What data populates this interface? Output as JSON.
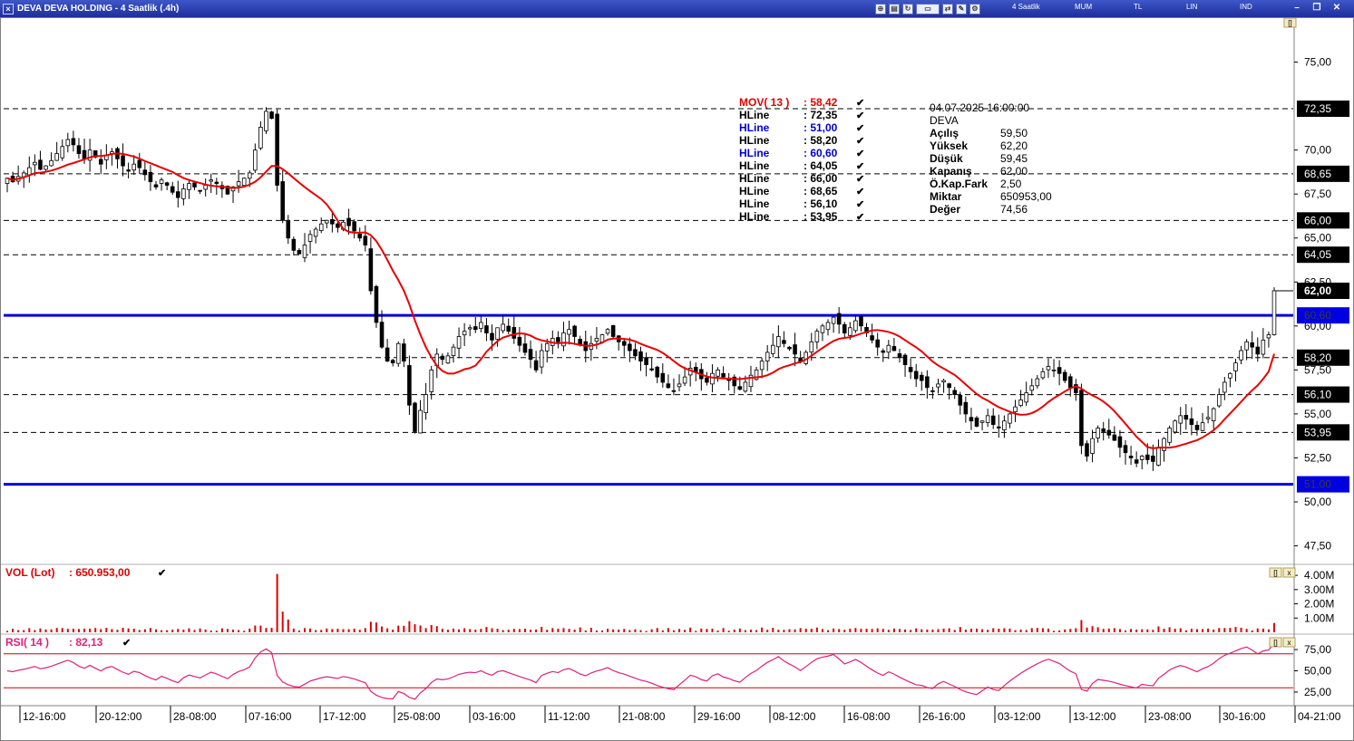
{
  "window": {
    "title": "DEVA DEVA HOLDING - 4 Saatlik (.4h)",
    "period_menu": "4 Saatlik",
    "menus": [
      "MUM",
      "TL",
      "LIN",
      "IND"
    ],
    "close_glyph": "×",
    "toolbar_icons": [
      "zoom-icon",
      "print-icon",
      "refresh-icon",
      "portfolio-icon",
      "compare-icon",
      "draw-icon",
      "settings-icon"
    ]
  },
  "price_panel": {
    "y_ticks": [
      "75,00",
      "70,00",
      "67,50",
      "65,00",
      "62,50",
      "60,00",
      "57,50",
      "55,00",
      "52,50",
      "50,00",
      "47,50"
    ],
    "price_tags": [
      {
        "text": "72,35",
        "value": 72.35,
        "kind": "line"
      },
      {
        "text": "68,65",
        "value": 68.65,
        "kind": "line"
      },
      {
        "text": "66,00",
        "value": 66.0,
        "kind": "line"
      },
      {
        "text": "64,05",
        "value": 64.05,
        "kind": "line"
      },
      {
        "text": "62,00",
        "value": 62.0,
        "kind": "price"
      },
      {
        "text": "60,60",
        "value": 60.6,
        "kind": "blue"
      },
      {
        "text": "58,20",
        "value": 58.2,
        "kind": "line"
      },
      {
        "text": "56,10",
        "value": 56.1,
        "kind": "line"
      },
      {
        "text": "53,95",
        "value": 53.95,
        "kind": "line"
      },
      {
        "text": "51,00",
        "value": 51.0,
        "kind": "blue"
      }
    ],
    "legend": [
      {
        "label": "MOV( 13 )",
        "value": ": 58,42",
        "color": "#e00000"
      },
      {
        "label": "HLine",
        "value": ": 72,35",
        "color": "#000000"
      },
      {
        "label": "HLine",
        "value": ": 51,00",
        "color": "#0000d0"
      },
      {
        "label": "HLine",
        "value": ": 58,20",
        "color": "#000000"
      },
      {
        "label": "HLine",
        "value": ": 60,60",
        "color": "#0000d0"
      },
      {
        "label": "HLine",
        "value": ": 64,05",
        "color": "#000000"
      },
      {
        "label": "HLine",
        "value": ": 66,00",
        "color": "#000000"
      },
      {
        "label": "HLine",
        "value": ": 68,65",
        "color": "#000000"
      },
      {
        "label": "HLine",
        "value": ": 56,10",
        "color": "#000000"
      },
      {
        "label": "HLine",
        "value": ": 53,95",
        "color": "#000000"
      }
    ],
    "check_glyph": "✔",
    "info": {
      "datetime": "04.07.2025    16:00:00",
      "symbol": "DEVA",
      "rows": [
        {
          "label": "Açılış",
          "value": "59,50"
        },
        {
          "label": "Yüksek",
          "value": "62,20"
        },
        {
          "label": "Düşük",
          "value": "59,45"
        },
        {
          "label": "Kapanış",
          "value": "62,00"
        },
        {
          "label": "Ö.Kap.Fark",
          "value": "2,50"
        },
        {
          "label": "Miktar",
          "value": "650953,00"
        },
        {
          "label": "Değer",
          "value": "74,56"
        }
      ]
    }
  },
  "volume_panel": {
    "legend_label": "VOL (Lot)",
    "legend_value": ": 650.953,00",
    "y_ticks": [
      "4.00M",
      "3.00M",
      "2.00M",
      "1.00M"
    ]
  },
  "rsi_panel": {
    "legend_label": "RSI( 14 )",
    "legend_value": ": 82,13",
    "y_ticks": [
      "75,00",
      "50,00",
      "25,00"
    ]
  },
  "x_axis": {
    "labels": [
      "12-16:00",
      "20-12:00",
      "28-08:00",
      "07-16:00",
      "17-12:00",
      "25-08:00",
      "03-16:00",
      "11-12:00",
      "21-08:00",
      "29-16:00",
      "08-12:00",
      "16-08:00",
      "26-16:00",
      "03-12:00",
      "13-12:00",
      "23-08:00",
      "30-16:00",
      "04-21:00"
    ]
  },
  "panel_buttons": [
    "[]",
    "x"
  ],
  "colors": {
    "ma": "#e80000",
    "blue_line": "#0000e0",
    "volume": "#e00000",
    "rsi": "#e0207a",
    "rsi_band": "#d40000",
    "title_bar": "#1d2f9a"
  },
  "chart_data": [
    {
      "type": "candlestick",
      "title": "DEVA DEVA HOLDING - 4 Saatlik (.4h)",
      "ylim": [
        46.5,
        77.5
      ],
      "moving_average": {
        "name": "MOV( 13 )",
        "period": 13,
        "last": 58.42
      },
      "horizontal_lines": [
        72.35,
        51.0,
        58.2,
        60.6,
        64.05,
        66.0,
        68.65,
        56.1,
        53.95
      ],
      "last_bar": {
        "open": 59.5,
        "high": 62.2,
        "low": 59.45,
        "close": 62.0
      },
      "closes": [
        68.4,
        68.2,
        68.5,
        68.7,
        69.0,
        69.3,
        68.9,
        69.1,
        69.4,
        69.8,
        70.2,
        70.6,
        70.3,
        69.8,
        69.5,
        70.0,
        69.6,
        69.2,
        69.7,
        69.9,
        69.5,
        69.1,
        68.8,
        69.2,
        69.0,
        68.6,
        68.2,
        67.9,
        68.3,
        68.0,
        67.6,
        67.3,
        67.8,
        68.1,
        67.9,
        67.7,
        68.0,
        68.3,
        68.1,
        67.8,
        67.5,
        67.9,
        68.2,
        68.4,
        68.7,
        70.0,
        71.3,
        72.2,
        71.8,
        68.0,
        66.0,
        65.0,
        64.3,
        64.1,
        64.6,
        65.2,
        65.5,
        65.8,
        66.0,
        65.8,
        65.6,
        65.9,
        65.7,
        65.4,
        65.0,
        64.6,
        62.0,
        60.2,
        58.8,
        58.0,
        57.9,
        59.0,
        58.0,
        55.5,
        54.0,
        55.2,
        56.1,
        57.5,
        58.4,
        58.1,
        58.3,
        58.8,
        59.4,
        59.7,
        59.9,
        59.8,
        60.2,
        59.6,
        59.2,
        59.9,
        60.1,
        59.7,
        59.3,
        58.9,
        58.5,
        58.1,
        57.5,
        58.6,
        59.0,
        59.3,
        59.1,
        59.6,
        59.8,
        59.4,
        58.9,
        58.6,
        59.0,
        59.3,
        59.5,
        59.8,
        59.4,
        59.1,
        58.9,
        58.6,
        58.3,
        58.0,
        57.8,
        57.5,
        57.1,
        56.8,
        56.5,
        56.3,
        56.7,
        57.1,
        57.6,
        57.4,
        57.0,
        56.8,
        57.3,
        57.5,
        57.1,
        56.9,
        56.6,
        56.4,
        56.8,
        57.2,
        57.5,
        58.0,
        58.5,
        58.9,
        59.4,
        59.0,
        58.7,
        58.4,
        58.0,
        58.5,
        59.1,
        59.7,
        60.0,
        60.2,
        60.5,
        60.1,
        59.6,
        59.9,
        60.3,
        60.0,
        59.6,
        59.2,
        58.8,
        58.5,
        58.9,
        58.6,
        58.2,
        57.8,
        57.4,
        57.0,
        56.9,
        56.5,
        56.3,
        56.7,
        56.9,
        56.5,
        56.1,
        55.5,
        55.0,
        54.6,
        54.3,
        54.6,
        54.9,
        54.4,
        54.2,
        54.6,
        55.0,
        55.4,
        55.8,
        56.2,
        56.6,
        57.0,
        57.4,
        57.7,
        57.5,
        57.3,
        56.9,
        56.5,
        56.2,
        53.2,
        52.6,
        53.6,
        54.2,
        54.0,
        53.8,
        53.5,
        53.1,
        52.8,
        52.5,
        52.2,
        52.6,
        52.4,
        52.3,
        53.1,
        53.6,
        54.2,
        54.6,
        54.9,
        54.7,
        54.4,
        54.1,
        54.5,
        54.8,
        55.3,
        56.1,
        56.8,
        57.3,
        57.9,
        58.6,
        59.1,
        58.8,
        58.4,
        59.2,
        59.5,
        62.0
      ]
    },
    {
      "type": "bar",
      "title": "VOL (Lot)",
      "last_value": 650953,
      "ylim": [
        0,
        4200000
      ]
    },
    {
      "type": "line",
      "title": "RSI( 14 )",
      "last_value": 82.13,
      "ylim": [
        10,
        90
      ],
      "bands": [
        70,
        30
      ]
    }
  ]
}
